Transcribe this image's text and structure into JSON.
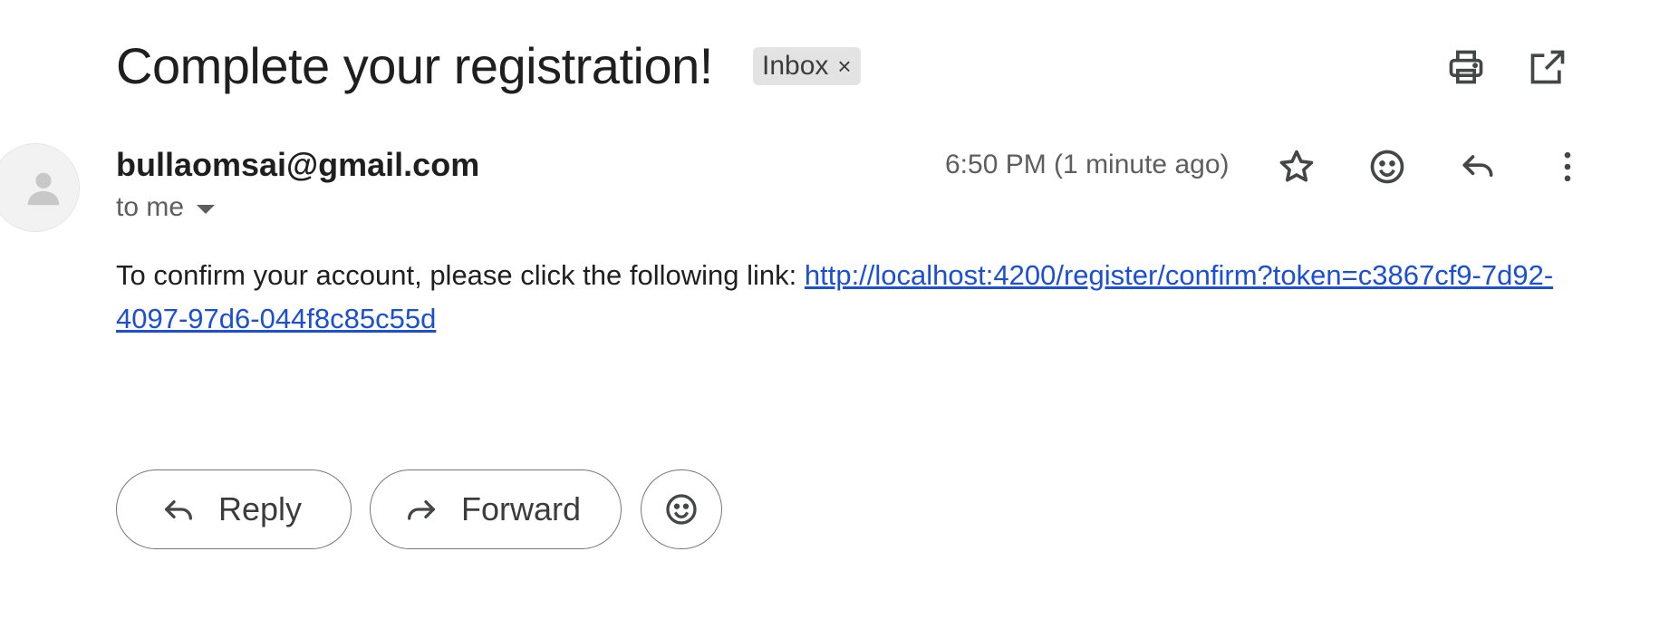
{
  "subject": "Complete your registration!",
  "label": {
    "name": "Inbox",
    "remove_glyph": "×"
  },
  "top_actions": [
    "print-icon",
    "open-in-new-window-icon"
  ],
  "sender": {
    "email": "bullaomsai@gmail.com",
    "recipient": "to me"
  },
  "timestamp": "6:50 PM (1 minute ago)",
  "header_actions": [
    "star-icon",
    "emoji-react-icon",
    "reply-icon",
    "more-vert-icon"
  ],
  "body": {
    "text": "To confirm your account, please click the following link: ",
    "link": "http://localhost:4200/register/confirm?token=c3867cf9-7d92-4097-97d6-044f8c85c55d"
  },
  "actions": {
    "reply_label": "Reply",
    "forward_label": "Forward"
  },
  "colors": {
    "link": "#1a4fd6",
    "chip_bg": "#e3e3e3",
    "text": "#1f1f1f",
    "muted": "#5e5e5e"
  }
}
